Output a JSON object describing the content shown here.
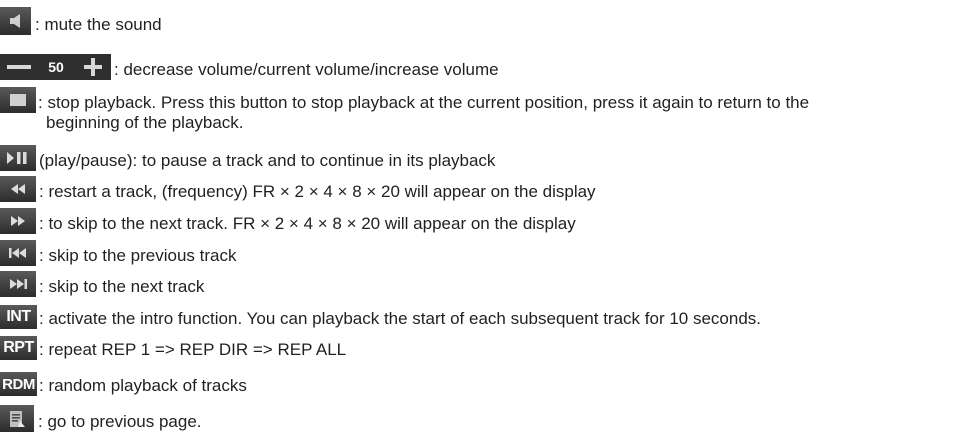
{
  "rows": [
    {
      "icon": "speaker-icon",
      "text": ": mute the sound"
    },
    {
      "icon": "volume-control",
      "volume_value": "50",
      "text": ": decrease volume/current volume/increase volume"
    },
    {
      "icon": "stop-icon",
      "text": ": stop playback. Press this button to stop playback at the current position, press it again to return to the",
      "text2": "beginning of the playback."
    },
    {
      "icon": "play-pause-icon",
      "text": "(play/pause): to pause a track and to continue in its playback"
    },
    {
      "icon": "rewind-icon",
      "text": ": restart a track, (frequency) FR × 2 × 4 × 8 × 20 will appear on the display"
    },
    {
      "icon": "fast-forward-icon",
      "text": ": to skip to the next track. FR × 2 × 4 × 8 × 20 will appear on the display"
    },
    {
      "icon": "skip-previous-icon",
      "text": ": skip to the previous track"
    },
    {
      "icon": "skip-next-icon",
      "text": ": skip to the next track"
    },
    {
      "icon": "intro-icon",
      "icon_text": "INT",
      "text": ": activate the intro function. You can playback the start of each subsequent track for 10 seconds."
    },
    {
      "icon": "repeat-icon",
      "icon_text": "RPT",
      "text": ": repeat REP 1 => REP DIR => REP ALL"
    },
    {
      "icon": "random-icon",
      "icon_text": "RDM",
      "text": ": random playback of tracks"
    },
    {
      "icon": "previous-page-icon",
      "text": ": go to previous page."
    }
  ]
}
